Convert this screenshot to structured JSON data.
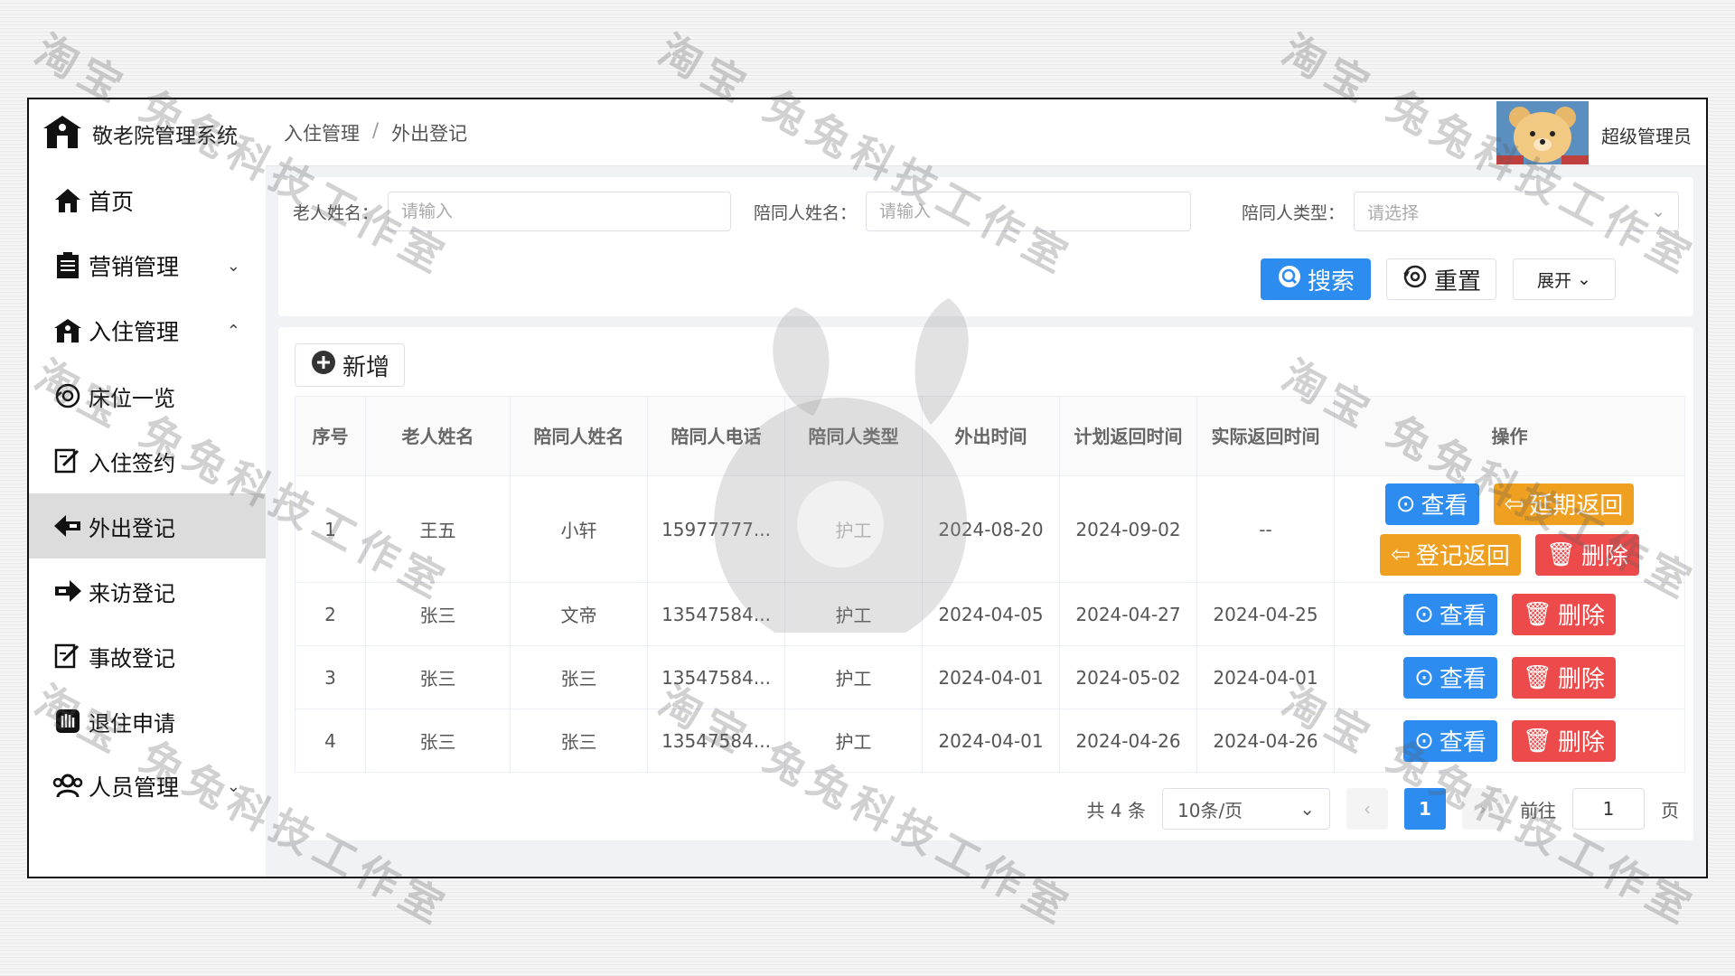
{
  "app": {
    "title": "敬老院管理系统"
  },
  "sidebar": {
    "items": [
      {
        "label": "首页",
        "icon": "home-icon",
        "arrow": ""
      },
      {
        "label": "营销管理",
        "icon": "document-icon",
        "arrow": "⌄"
      },
      {
        "label": "入住管理",
        "icon": "building-icon",
        "arrow": "⌃"
      },
      {
        "label": "床位一览",
        "icon": "bed-icon",
        "arrow": ""
      },
      {
        "label": "入住签约",
        "icon": "sign-icon",
        "arrow": ""
      },
      {
        "label": "外出登记",
        "icon": "exit-icon",
        "arrow": "",
        "active": true
      },
      {
        "label": "来访登记",
        "icon": "enter-icon",
        "arrow": ""
      },
      {
        "label": "事故登记",
        "icon": "edit-icon",
        "arrow": ""
      },
      {
        "label": "退住申请",
        "icon": "hand-icon",
        "arrow": ""
      },
      {
        "label": "人员管理",
        "icon": "people-icon",
        "arrow": "⌄"
      }
    ]
  },
  "header": {
    "breadcrumb": [
      "入住管理",
      "外出登记"
    ],
    "user_name": "超级管理员"
  },
  "search": {
    "elder_label": "老人姓名：",
    "elder_placeholder": "请输入",
    "companion_label": "陪同人姓名：",
    "companion_placeholder": "请输入",
    "type_label": "陪同人类型：",
    "type_placeholder": "请选择",
    "search_btn": "搜索",
    "reset_btn": "重置",
    "expand_btn": "展开"
  },
  "toolbar": {
    "add_btn": "新增"
  },
  "table": {
    "columns": [
      "序号",
      "老人姓名",
      "陪同人姓名",
      "陪同人电话",
      "陪同人类型",
      "外出时间",
      "计划返回时间",
      "实际返回时间",
      "操作"
    ],
    "rows": [
      {
        "no": "1",
        "elder": "王五",
        "companion": "小轩",
        "phone": "15977777...",
        "type": "护工",
        "out": "2024-08-20",
        "plan": "2024-09-02",
        "actual": "--"
      },
      {
        "no": "2",
        "elder": "张三",
        "companion": "文帝",
        "phone": "13547584...",
        "type": "护工",
        "out": "2024-04-05",
        "plan": "2024-04-27",
        "actual": "2024-04-25"
      },
      {
        "no": "3",
        "elder": "张三",
        "companion": "张三",
        "phone": "13547584...",
        "type": "护工",
        "out": "2024-04-01",
        "plan": "2024-05-02",
        "actual": "2024-04-01"
      },
      {
        "no": "4",
        "elder": "张三",
        "companion": "张三",
        "phone": "13547584...",
        "type": "护工",
        "out": "2024-04-01",
        "plan": "2024-04-26",
        "actual": "2024-04-26"
      }
    ],
    "ops": {
      "view": "查看",
      "delay": "延期返回",
      "return": "登记返回",
      "delete": "删除"
    }
  },
  "pagination": {
    "total": "共 4 条",
    "page_size": "10条/页",
    "current": "1",
    "goto_label": "前往",
    "goto_value": "1",
    "page_suffix": "页"
  },
  "watermark": {
    "text": "淘宝 兔兔科技工作室"
  },
  "colors": {
    "primary": "#2d8cf0",
    "danger": "#ed4b4b",
    "warning": "#f0a020"
  }
}
